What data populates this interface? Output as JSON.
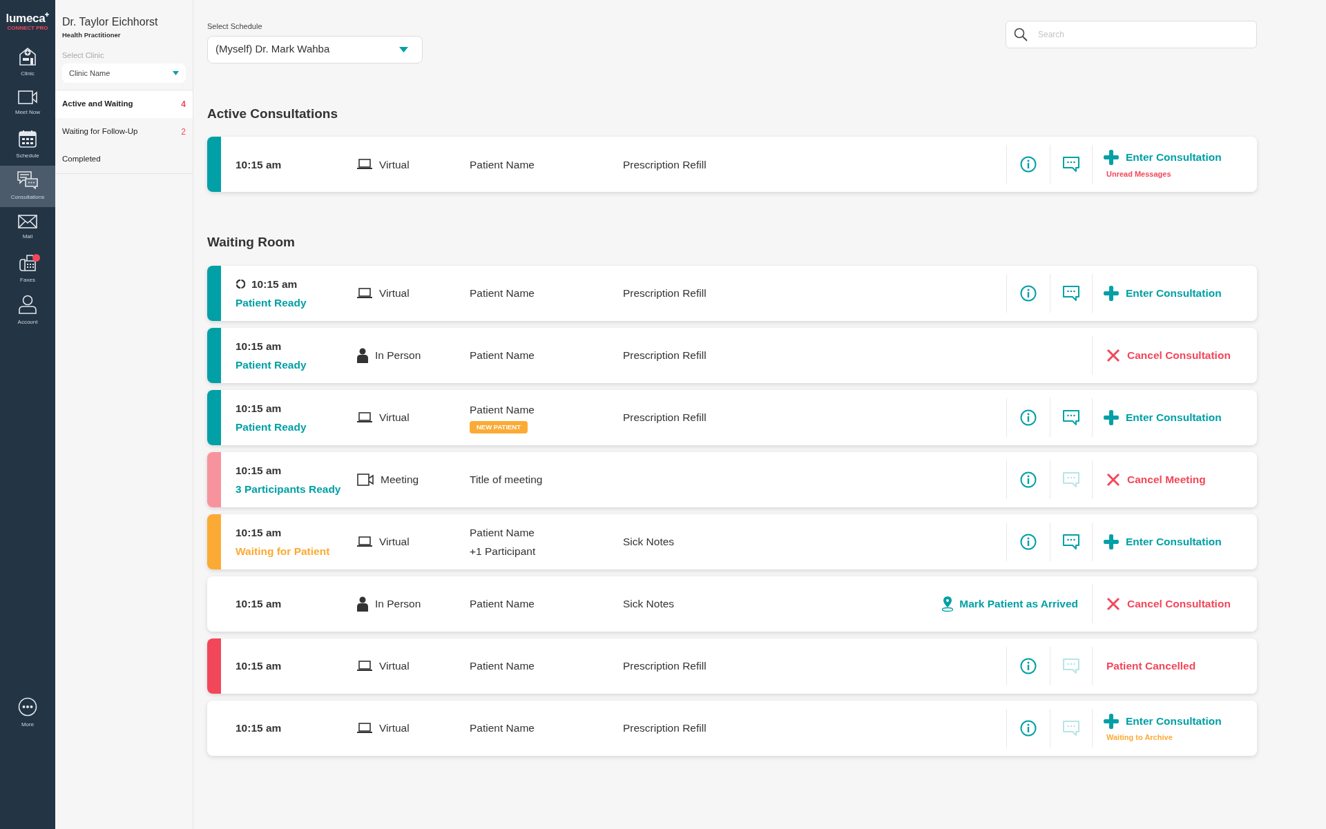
{
  "rail": {
    "logo": "lumeca",
    "logo_sub": "CONNECT PRO",
    "items": [
      {
        "kind": "clinic",
        "label": "Clinic",
        "selected": false,
        "alert": false
      },
      {
        "kind": "video",
        "label": "Meet Now",
        "selected": false,
        "alert": false
      },
      {
        "kind": "calendar",
        "label": "Schedule",
        "selected": false,
        "alert": false
      },
      {
        "kind": "chat",
        "label": "Consultations",
        "selected": true,
        "alert": false
      },
      {
        "kind": "mail",
        "label": "Mail",
        "selected": false,
        "alert": false
      },
      {
        "kind": "fax",
        "label": "Faxes",
        "selected": false,
        "alert": true
      },
      {
        "kind": "user",
        "label": "Account",
        "selected": false,
        "alert": false
      }
    ],
    "bottom_items": [
      {
        "kind": "more",
        "label": "More",
        "selected": false,
        "alert": false
      }
    ]
  },
  "panel": {
    "name": "Dr. Taylor Eichhorst",
    "role": "Health Practitioner",
    "clinic_label": "Select Clinic",
    "clinic_value": "Clinic Name",
    "items": [
      {
        "label": "Active and Waiting",
        "count": "4",
        "selected": true
      },
      {
        "label": "Waiting for Follow-Up",
        "count": "2",
        "selected": false
      },
      {
        "label": "Completed",
        "selected": false
      }
    ]
  },
  "schedule": {
    "label": "Select Schedule",
    "value": "(Myself) Dr. Mark Wahba"
  },
  "search": {
    "placeholder": "Search"
  },
  "sections": [
    {
      "title": "Active Consultations",
      "rows": [
        {
          "color": "#00a0a6",
          "loading": false,
          "time": "10:15 am",
          "mode": {
            "kind": "virtual",
            "text": "Virtual"
          },
          "name": "Patient Name",
          "reason": "Prescription Refill",
          "tools": true,
          "chat_enabled": true,
          "action": {
            "kind": "enter",
            "label": "Enter Consultation"
          },
          "note": {
            "kind": "alert",
            "text": "Unread Messages"
          }
        }
      ]
    },
    {
      "title": "Waiting Room",
      "rows": [
        {
          "color": "#00a0a6",
          "loading": true,
          "time": "10:15 am",
          "status": {
            "kind": "ready",
            "text": "Patient Ready"
          },
          "mode": {
            "kind": "virtual",
            "text": "Virtual"
          },
          "name": "Patient Name",
          "reason": "Prescription Refill",
          "tools": true,
          "chat_enabled": true,
          "action": {
            "kind": "enter",
            "label": "Enter Consultation"
          }
        },
        {
          "color": "#00a0a6",
          "loading": false,
          "time": "10:15 am",
          "status": {
            "kind": "ready",
            "text": "Patient Ready"
          },
          "mode": {
            "kind": "person",
            "text": "In Person"
          },
          "name": "Patient Name",
          "reason": "Prescription Refill",
          "tools": false,
          "action": {
            "kind": "cancel",
            "label": "Cancel Consultation"
          }
        },
        {
          "color": "#00a0a6",
          "loading": false,
          "time": "10:15 am",
          "status": {
            "kind": "ready",
            "text": "Patient Ready"
          },
          "mode": {
            "kind": "virtual",
            "text": "Virtual"
          },
          "name": "Patient Name",
          "badge": "NEW PATIENT",
          "reason": "Prescription Refill",
          "tools": true,
          "chat_enabled": true,
          "action": {
            "kind": "enter",
            "label": "Enter Consultation"
          }
        },
        {
          "color": "#f7939c",
          "loading": false,
          "time": "10:15 am",
          "status": {
            "kind": "ready",
            "text": "3 Participants Ready"
          },
          "mode": {
            "kind": "meeting",
            "text": "Meeting"
          },
          "name": "Title of meeting",
          "tools": true,
          "chat_enabled": false,
          "action": {
            "kind": "cancel",
            "label": "Cancel Meeting"
          }
        },
        {
          "color": "#fbab35",
          "loading": false,
          "time": "10:15 am",
          "status": {
            "kind": "waiting",
            "text": "Waiting for Patient"
          },
          "mode": {
            "kind": "virtual",
            "text": "Virtual"
          },
          "name": "Patient Name",
          "name_extra": "+1 Participant",
          "reason": "Sick Notes",
          "tools": true,
          "chat_enabled": true,
          "action": {
            "kind": "enter",
            "label": "Enter Consultation"
          }
        },
        {
          "loading": false,
          "time": "10:15 am",
          "mode": {
            "kind": "person",
            "text": "In Person"
          },
          "name": "Patient Name",
          "reason": "Sick Notes",
          "tools": false,
          "arrive": "Mark Patient as Arrived",
          "action": {
            "kind": "cancel",
            "label": "Cancel Consultation"
          }
        },
        {
          "color": "#f2475a",
          "loading": false,
          "time": "10:15 am",
          "mode": {
            "kind": "virtual",
            "text": "Virtual"
          },
          "name": "Patient Name",
          "reason": "Prescription Refill",
          "tools": true,
          "chat_enabled": false,
          "action": {
            "kind": "status",
            "label": "Patient Cancelled"
          }
        },
        {
          "loading": false,
          "time": "10:15 am",
          "mode": {
            "kind": "virtual",
            "text": "Virtual"
          },
          "name": "Patient Name",
          "reason": "Prescription Refill",
          "tools": true,
          "chat_enabled": false,
          "action": {
            "kind": "enter",
            "label": "Enter Consultation"
          },
          "note": {
            "kind": "pending",
            "text": "Waiting to Archive"
          }
        }
      ]
    }
  ]
}
